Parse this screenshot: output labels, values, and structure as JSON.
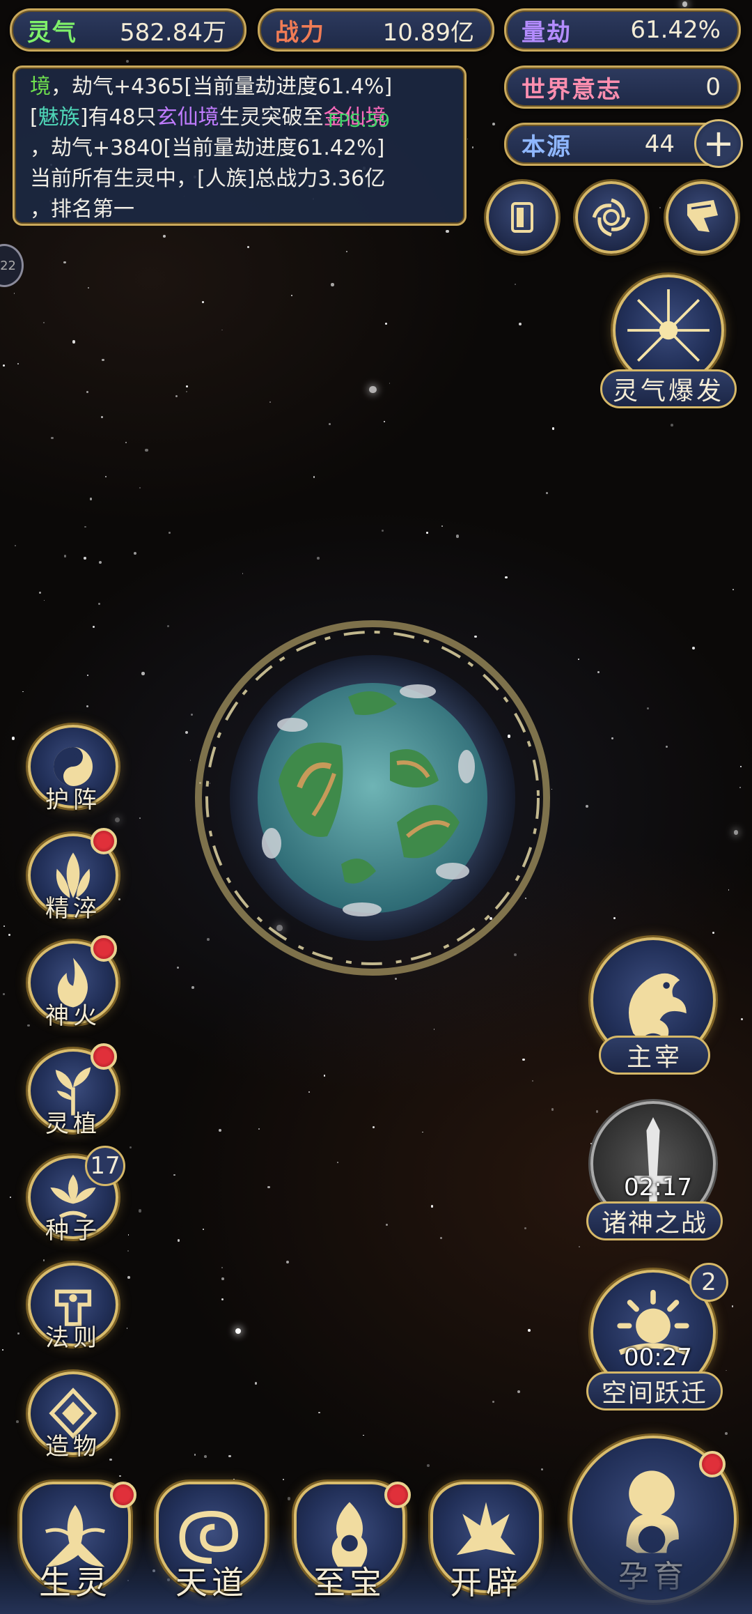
{
  "resources": {
    "lingqi": {
      "label": "灵气",
      "value": "582.84万"
    },
    "zhanli": {
      "label": "战力",
      "value": "10.89亿"
    },
    "liangjie": {
      "label": "量劫",
      "value": "61.42%"
    },
    "shijie_yizhi": {
      "label": "世界意志",
      "value": "0"
    },
    "benyuan": {
      "label": "本源",
      "value": "44"
    }
  },
  "log": {
    "line1": {
      "a": "境",
      "b": "，劫气+4365[当前量劫进度61.4%]"
    },
    "line2": {
      "a": "[",
      "b": "魅族",
      "c": "]有48只",
      "d": "玄仙境",
      "e": "生灵突破至",
      "f": "金仙境"
    },
    "line3": "，劫气+3840[当前量劫进度61.42%]",
    "line4": "当前所有生灵中，[人族]总战力3.36亿",
    "line5": "，排名第一",
    "float_text": "FPS:59",
    "edge_tab": "22"
  },
  "top_buttons": [
    "card-icon",
    "vortex-icon",
    "flag-icon"
  ],
  "lingqi_burst": {
    "label": "灵气爆发",
    "icon": "burst-icon"
  },
  "side_menu": [
    {
      "label": "护阵",
      "icon": "yin-yang-icon",
      "dot": false
    },
    {
      "label": "精淬",
      "icon": "lotus-flame-icon",
      "dot": true
    },
    {
      "label": "神火",
      "icon": "fire-icon",
      "dot": true
    },
    {
      "label": "灵植",
      "icon": "plant-icon",
      "dot": true
    },
    {
      "label": "种子",
      "icon": "seed-icon",
      "badge": "17"
    },
    {
      "label": "法则",
      "icon": "rune-icon",
      "dot": false
    },
    {
      "label": "造物",
      "icon": "diamond-icon",
      "dot": false
    }
  ],
  "right_menu": {
    "zhuzai": {
      "label": "主宰",
      "icon": "dragon-icon"
    },
    "zhushen": {
      "label": "诸神之战",
      "timer": "02:17",
      "icon": "sword-icon"
    },
    "kongjian": {
      "label": "空间跃迁",
      "timer": "00:27",
      "badge": "2",
      "icon": "sun-icon"
    },
    "yunyu": {
      "label": "孕育",
      "icon": "figure-icon",
      "dot": true
    }
  },
  "bottom_menu": [
    {
      "label": "生灵",
      "icon": "phoenix-icon",
      "dot": true
    },
    {
      "label": "天道",
      "icon": "cloud-swirl-icon",
      "dot": false
    },
    {
      "label": "至宝",
      "icon": "treasure-icon",
      "dot": true
    },
    {
      "label": "开辟",
      "icon": "axe-icon",
      "dot": false
    }
  ],
  "colors": {
    "gold": "#d6b868",
    "panel": "#1e2947",
    "accent_red": "#e0303a"
  }
}
